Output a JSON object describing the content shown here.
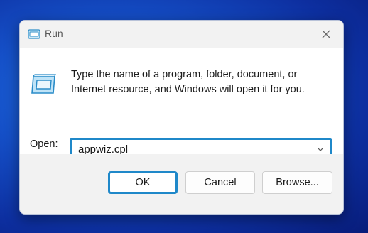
{
  "window": {
    "title": "Run"
  },
  "content": {
    "description": "Type the name of a program, folder, document, or Internet resource, and Windows will open it for you.",
    "open_label": "Open:",
    "open_value": "appwiz.cpl"
  },
  "buttons": {
    "ok_label": "OK",
    "cancel_label": "Cancel",
    "browse_label": "Browse..."
  },
  "icons": {
    "title": "run-app-icon",
    "main": "run-app-icon",
    "close": "close-icon",
    "dropdown": "chevron-down-icon"
  },
  "colors": {
    "focus_accent": "#1f88c9",
    "titlebar_bg": "#f2f2f2",
    "footer_bg": "#f2f2f2",
    "desktop_bg": "#1550c8"
  }
}
